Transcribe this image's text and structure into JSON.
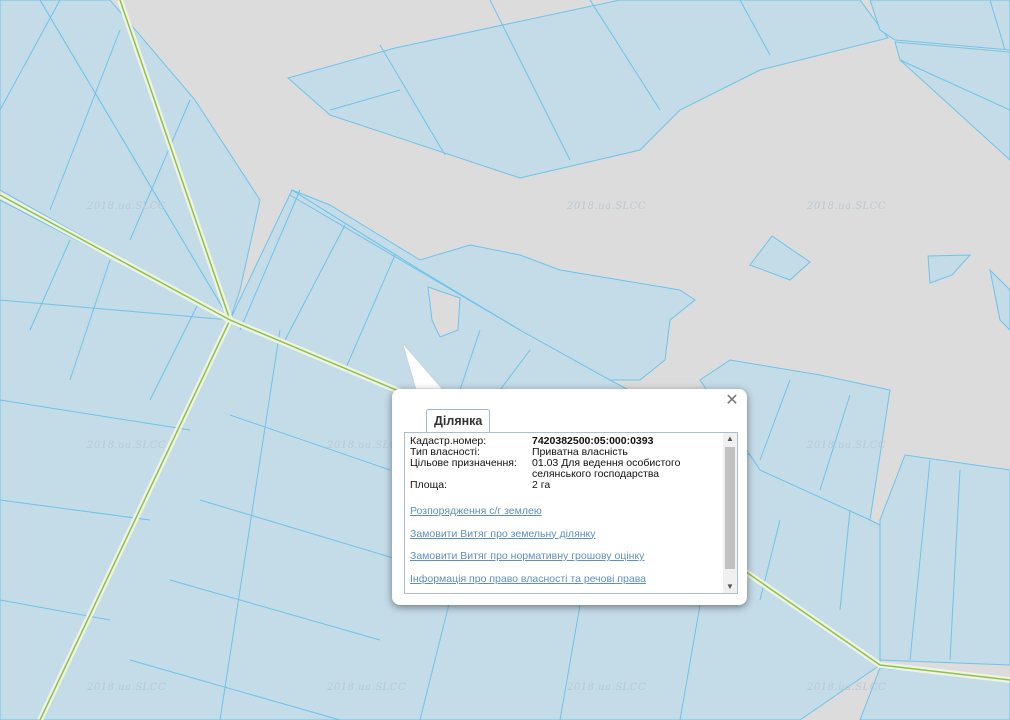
{
  "map": {
    "watermark": "2018.ua.SLCC",
    "colors": {
      "background": "#dcdcdc",
      "parcel_fill": "#c4dbe8",
      "parcel_border": "#6fc3ea",
      "road_line": "#8bc34a",
      "road_halo": "#e8ecd2"
    }
  },
  "popup": {
    "tab_label": "Ділянка",
    "close_icon": "close-icon",
    "fields": [
      {
        "label": "Кадастр.номер:",
        "value": "7420382500:05:000:0393"
      },
      {
        "label": "Тип власності:",
        "value": "Приватна власність"
      },
      {
        "label": "Цільове призначення:",
        "value": "01.03 Для ведення особистого селянського господарства"
      },
      {
        "label": "Площа:",
        "value": "2 га"
      }
    ],
    "links": [
      "Розпорядження с/г землею",
      "Замовити Витяг про земельну ділянку",
      "Замовити Витяг про нормативну грошову оцінку",
      "Інформація про право власності та речові права"
    ]
  }
}
